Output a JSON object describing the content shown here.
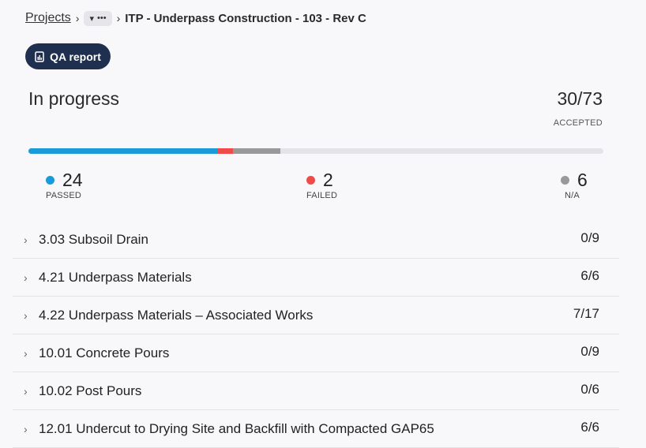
{
  "breadcrumb": {
    "root": "Projects",
    "current": "ITP - Underpass Construction - 103 - Rev C"
  },
  "qa_report": {
    "label": "QA report"
  },
  "summary": {
    "status": "In progress",
    "accepted": "30/73",
    "accepted_label": "ACCEPTED",
    "progress": {
      "passed_fraction": 0.329,
      "failed_fraction": 0.027,
      "na_fraction": 0.082
    },
    "colors": {
      "passed": "#1a9bd7",
      "failed": "#f04b4b",
      "na": "#999999",
      "track": "#e4e4e8"
    },
    "stats": [
      {
        "value": "24",
        "label": "PASSED"
      },
      {
        "value": "2",
        "label": "FAILED"
      },
      {
        "value": "6",
        "label": "N/A"
      }
    ]
  },
  "items": [
    {
      "title": "3.03 Subsoil Drain",
      "count": "0/9"
    },
    {
      "title": "4.21 Underpass Materials",
      "count": "6/6"
    },
    {
      "title": "4.22 Underpass Materials – Associated Works",
      "count": "7/17"
    },
    {
      "title": "10.01 Concrete Pours",
      "count": "0/9"
    },
    {
      "title": "10.02 Post Pours",
      "count": "0/6"
    },
    {
      "title": "12.01 Undercut to Drying Site and Backfill with Compacted GAP65",
      "count": "6/6"
    }
  ]
}
